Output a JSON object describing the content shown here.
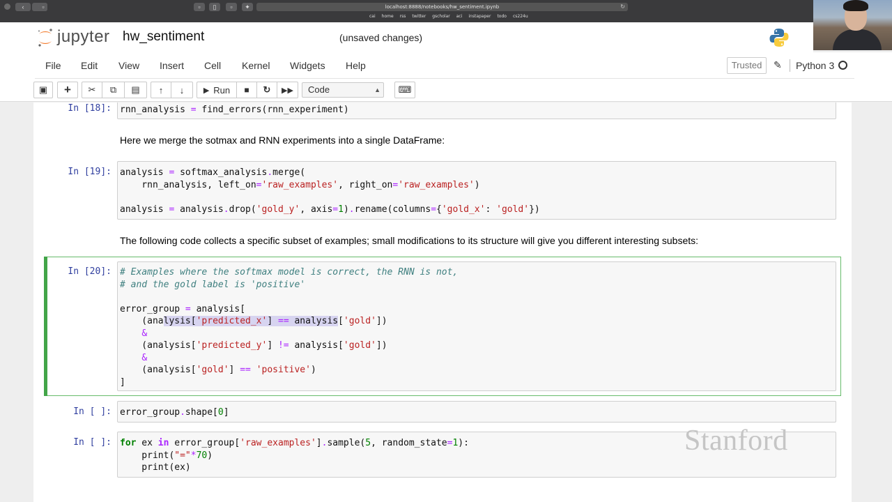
{
  "browser": {
    "url": "localhost:8888/notebooks/hw_sentiment.ipynb",
    "bookmarks": [
      "cai",
      "home",
      "rss",
      "twitter",
      "gscholar",
      "aci",
      "instapaper",
      "todo",
      "cs224u"
    ]
  },
  "header": {
    "logo_text": "jupyter",
    "notebook_name": "hw_sentiment",
    "save_status": "(unsaved changes)"
  },
  "menubar": {
    "items": [
      "File",
      "Edit",
      "View",
      "Insert",
      "Cell",
      "Kernel",
      "Widgets",
      "Help"
    ],
    "trusted_label": "Trusted",
    "kernel_name": "Python 3"
  },
  "toolbar": {
    "run_label": "Run",
    "cell_type": "Code"
  },
  "cells": {
    "c18": {
      "prompt": "In [18]:",
      "code": "rnn_analysis = find_errors(rnn_experiment)"
    },
    "md1": {
      "text": "Here we merge the sotmax and RNN experiments into a single DataFrame:"
    },
    "c19": {
      "prompt": "In [19]:",
      "lines": [
        "analysis = softmax_analysis.merge(",
        "    rnn_analysis, left_on='raw_examples', right_on='raw_examples')",
        "",
        "analysis = analysis.drop('gold_y', axis=1).rename(columns={'gold_x': 'gold'})"
      ]
    },
    "md2": {
      "text": "The following code collects a specific subset of examples; small modifications to its structure will give you different interesting subsets:"
    },
    "c20": {
      "prompt": "In [20]:",
      "lines": [
        "# Examples where the softmax model is correct, the RNN is not,",
        "# and the gold label is 'positive'",
        "",
        "error_group = analysis[",
        "    (analysis['predicted_x'] == analysis['gold'])",
        "    &",
        "    (analysis['predicted_y'] != analysis['gold'])",
        "    &",
        "    (analysis['gold'] == 'positive')",
        "]"
      ]
    },
    "c_shape": {
      "prompt": "In [ ]:",
      "code": "error_group.shape[0]"
    },
    "c_loop": {
      "prompt": "In [ ]:",
      "lines": [
        "for ex in error_group['raw_examples'].sample(5, random_state=1):",
        "    print(\"=\"*70)",
        "    print(ex)"
      ]
    }
  },
  "watermark": "Stanford"
}
